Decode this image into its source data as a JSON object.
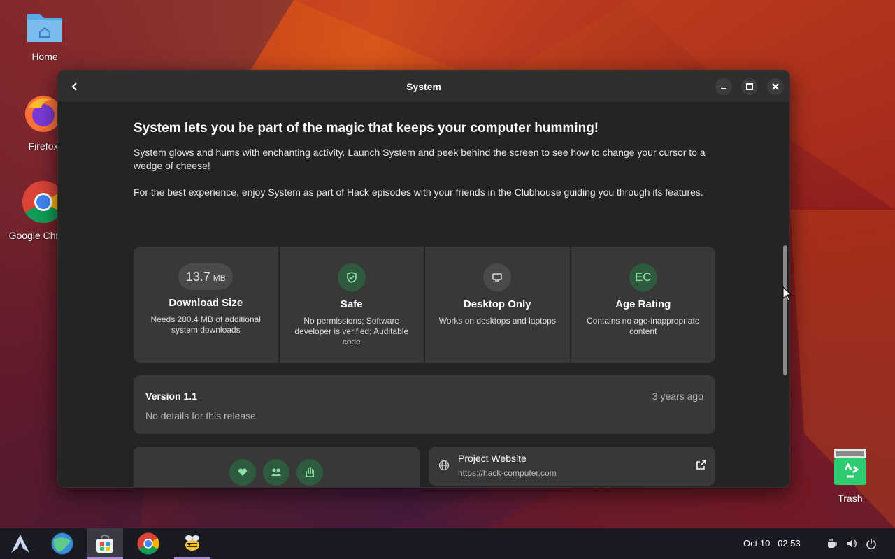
{
  "desktop": {
    "icons": [
      {
        "label": "Home",
        "icon": "folder-home-icon"
      },
      {
        "label": "Firefox",
        "icon": "firefox-icon"
      },
      {
        "label": "Google Chrome",
        "icon": "chrome-icon"
      },
      {
        "label": "Trash",
        "icon": "trash-icon"
      }
    ]
  },
  "window": {
    "title": "System",
    "headline": "System lets you be part of the magic that keeps your computer humming!",
    "paragraphs": [
      "System glows and hums with enchanting activity. Launch System and peek behind the screen to see how to change your cursor to a wedge of cheese!",
      "For the best experience, enjoy System as part of Hack episodes with your friends in the Clubhouse guiding you through its features."
    ],
    "tiles": [
      {
        "badge_value": "13.7",
        "badge_unit": "MB",
        "name": "Download Size",
        "desc": "Needs 280.4 MB of additional system downloads"
      },
      {
        "badge_icon": "shield-check-icon",
        "name": "Safe",
        "desc": "No permissions; Software developer is verified; Auditable code"
      },
      {
        "badge_icon": "desktop-icon",
        "name": "Desktop Only",
        "desc": "Works on desktops and laptops"
      },
      {
        "badge_text": "EC",
        "name": "Age Rating",
        "desc": "Contains no age-inappropriate content"
      }
    ],
    "version": {
      "title": "Version 1.1",
      "date": "3 years ago",
      "details": "No details for this release"
    },
    "tags": [
      "heart-icon",
      "people-icon",
      "hand-icon"
    ],
    "website": {
      "title": "Project Website",
      "url": "https://hack-computer.com"
    }
  },
  "taskbar": {
    "apps": [
      "arch-menu-icon",
      "browser-globe-icon",
      "software-store-icon",
      "chrome-icon",
      "hack-bee-icon"
    ],
    "active_app": "software-store-icon",
    "date": "Oct 10",
    "time": "02:53",
    "tray": [
      "coffee-icon",
      "volume-icon",
      "power-icon"
    ]
  },
  "colors": {
    "window_bg": "#242424",
    "card_bg": "#383838",
    "safe_green": "#2e5a3e",
    "accent_purple": "#a98bd8"
  }
}
